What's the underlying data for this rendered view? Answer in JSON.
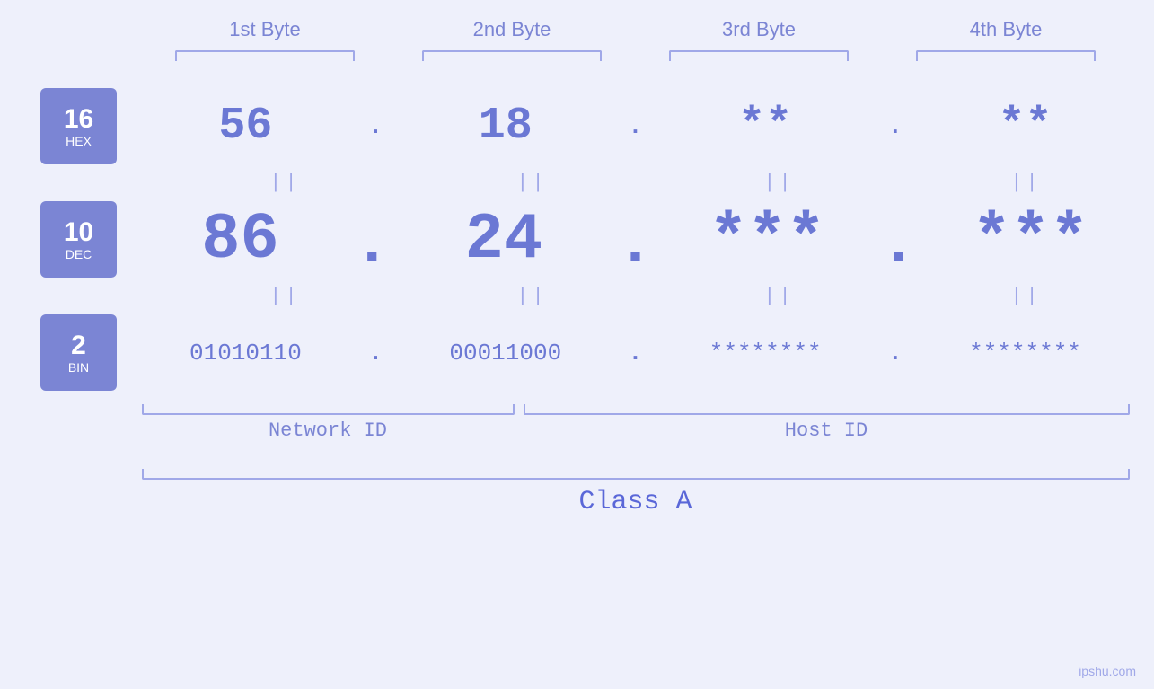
{
  "header": {
    "byte1": "1st Byte",
    "byte2": "2nd Byte",
    "byte3": "3rd Byte",
    "byte4": "4th Byte"
  },
  "badges": {
    "hex": {
      "number": "16",
      "label": "HEX"
    },
    "dec": {
      "number": "10",
      "label": "DEC"
    },
    "bin": {
      "number": "2",
      "label": "BIN"
    }
  },
  "hex_row": {
    "b1": "56",
    "b2": "18",
    "b3": "**",
    "b4": "**",
    "dot": "."
  },
  "dec_row": {
    "b1": "86",
    "b2": "24",
    "b3": "***",
    "b4": "***",
    "dot": "."
  },
  "bin_row": {
    "b1": "01010110",
    "b2": "00011000",
    "b3": "********",
    "b4": "********",
    "dot": "."
  },
  "labels": {
    "network_id": "Network ID",
    "host_id": "Host ID",
    "class": "Class A"
  },
  "watermark": "ipshu.com"
}
